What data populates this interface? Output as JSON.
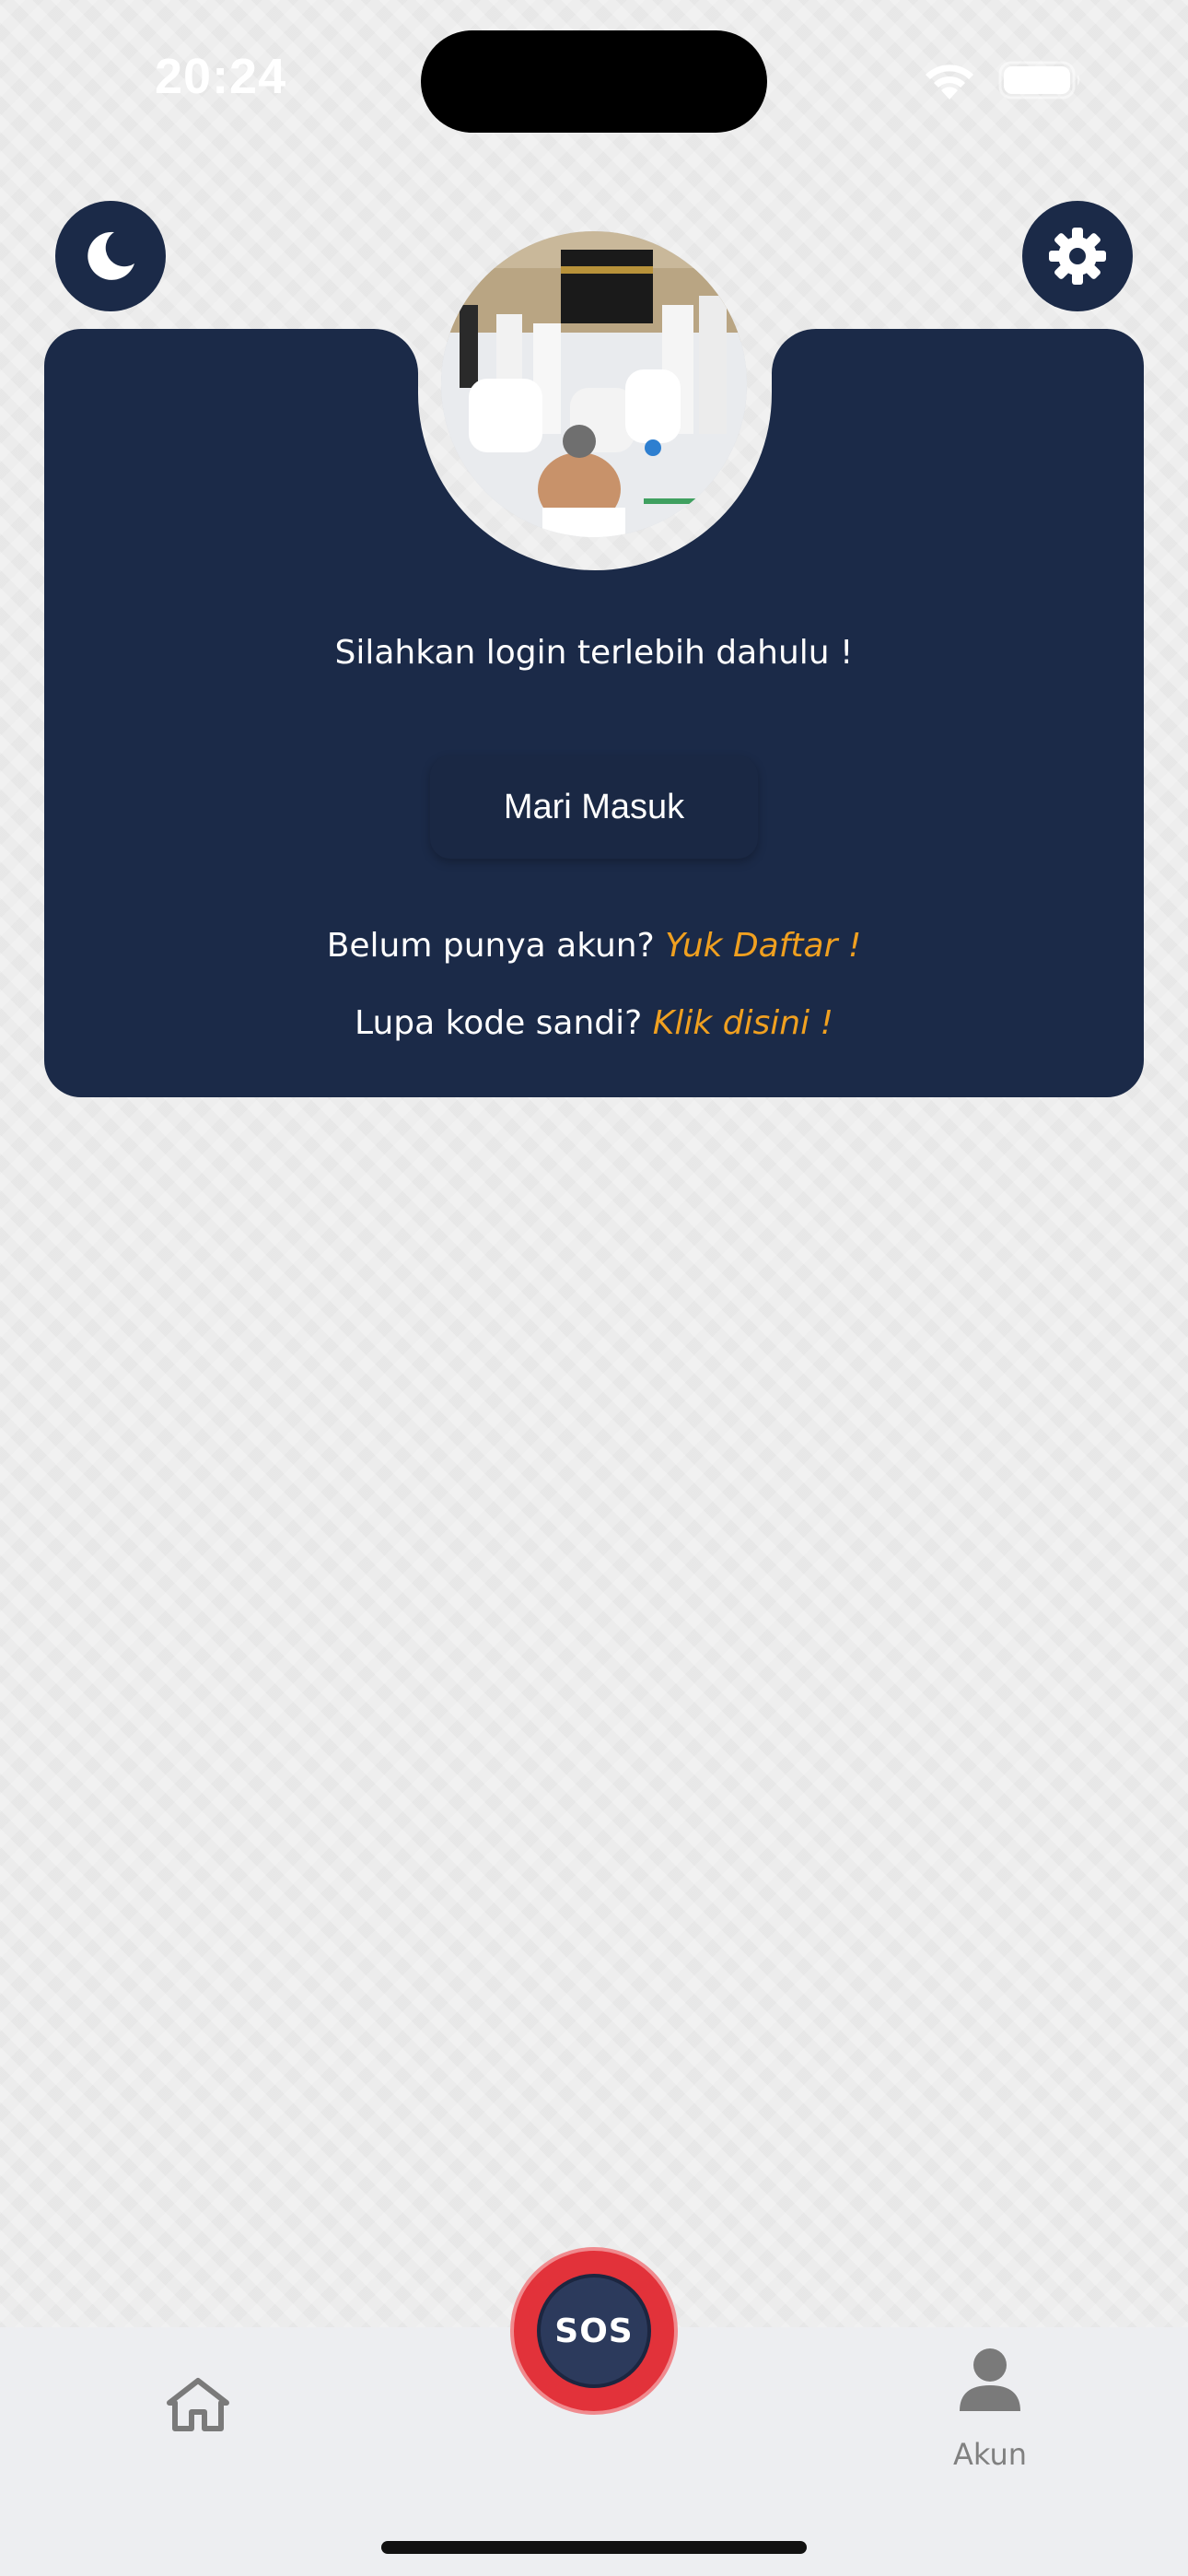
{
  "status_bar": {
    "time": "20:24",
    "icons": [
      "wifi-icon",
      "battery-icon"
    ]
  },
  "header": {
    "theme_toggle_icon": "moon-icon",
    "settings_icon": "gear-icon"
  },
  "profile_card": {
    "avatar_icon": "avatar-photo",
    "prompt": "Silahkan login terlebih dahulu !",
    "login_button_label": "Mari Masuk",
    "register_text": "Belum punya akun?",
    "register_link": "Yuk Daftar !",
    "forgot_text": "Lupa kode sandi?",
    "forgot_link": "Klik disini !"
  },
  "tab_bar": {
    "home_icon": "home-icon",
    "sos_label": "SOS",
    "account_label": "Akun",
    "account_icon": "user-icon"
  },
  "colors": {
    "primary": "#1b2a48",
    "link": "#f0a020",
    "sos": "#e2323a",
    "background": "#ececec"
  }
}
